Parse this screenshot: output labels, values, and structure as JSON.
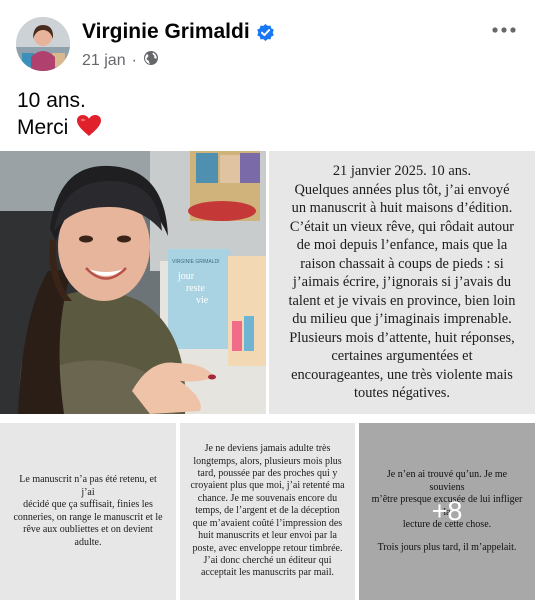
{
  "post": {
    "author": "Virginie Grimaldi",
    "date": "21 jan",
    "lines": [
      "10 ans.",
      "Merci"
    ]
  },
  "icons": {
    "verified": "verified-badge-icon",
    "audience": "globe-icon",
    "more": "more-options-icon",
    "heart": "red-heart-emoji"
  },
  "colors": {
    "verified": "#1877f2",
    "heart": "#e0202b",
    "secondary_text": "#65676b"
  },
  "media": {
    "tile1_lines": [
      "21 janvier 2025. 10 ans.",
      "Quelques années plus tôt, j’ai envoyé",
      "un manuscrit à huit maisons d’édition.",
      "C’était un vieux rêve, qui rôdait autour",
      "de moi depuis l’enfance, mais que la",
      "raison chassait à coups de pieds : si",
      "j’aimais écrire, j’ignorais si j’avais du",
      "talent et je vivais en province, bien loin",
      "du milieu que j’imaginais imprenable.",
      "Plusieurs mois d’attente, huit réponses,",
      "certaines argumentées et",
      "encourageantes, une très violente mais",
      "toutes négatives."
    ],
    "tile2_lines": [
      "Le manuscrit n’a pas été retenu, et j’ai",
      "décidé que ça suffisait, finies les",
      "conneries, on range le manuscrit et le",
      "rêve aux oubliettes et on devient",
      "adulte."
    ],
    "tile3_lines": [
      "Je ne deviens jamais adulte très",
      "longtemps, alors, plusieurs mois plus",
      "tard, poussée par des proches qui y",
      "croyaient plus que moi, j’ai retenté ma",
      "chance. Je me souvenais encore du",
      "temps, de l’argent et de la déception",
      "que m’avaient coûté l’impression des",
      "huit manuscrits et leur envoi par la",
      "poste, avec enveloppe retour timbrée.",
      "J’ai donc cherché un éditeur qui",
      "acceptait les manuscrits par mail."
    ],
    "tile4_lines": [
      "Je n’en ai trouvé qu’un. Je me souviens",
      "m’être presque excusée de lui infliger la",
      "lecture de cette chose."
    ],
    "tile4_caption": "Trois jours plus tard, il m’appelait.",
    "more_count": "+8",
    "book_cover_title": "VIRGINIE GRIMALDI",
    "book_cover_words": [
      "jour",
      "reste",
      "vie"
    ]
  }
}
